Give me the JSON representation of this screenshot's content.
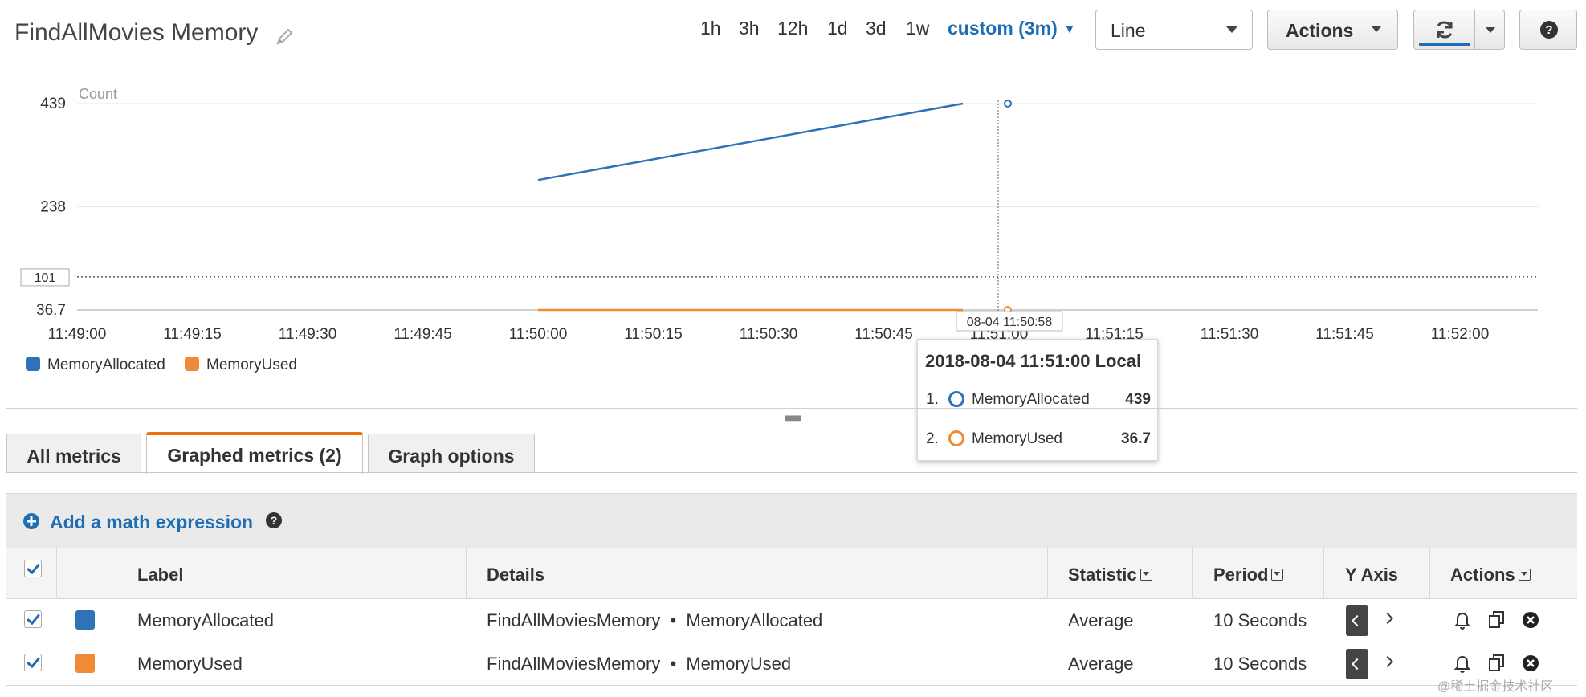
{
  "header": {
    "title": "FindAllMovies Memory",
    "time_ranges": [
      "1h",
      "3h",
      "12h",
      "1d",
      "3d",
      "1w"
    ],
    "custom_range_label": "custom (3m)",
    "chart_type_value": "Line",
    "actions_label": "Actions",
    "help_label": "?"
  },
  "chart_data": {
    "type": "line",
    "ylabel": "Count",
    "y_ticks": [
      "439",
      "238",
      "36.7"
    ],
    "threshold_label": "101",
    "x_ticks": [
      "11:49:00",
      "11:49:15",
      "11:49:30",
      "11:49:45",
      "11:50:00",
      "11:50:15",
      "11:50:30",
      "11:50:45",
      "11:51:00",
      "11:51:15",
      "11:51:30",
      "11:51:45",
      "11:52:00"
    ],
    "hover_label": "08-04 11:50:58",
    "threshold": 101,
    "grid": true,
    "series": [
      {
        "name": "MemoryAllocated",
        "color": "#2e73b8",
        "x": [
          "11:50:00",
          "11:51:00"
        ],
        "y": [
          290,
          439
        ],
        "hover_value": 439
      },
      {
        "name": "MemoryUsed",
        "color": "#ef8a36",
        "x": [
          "11:50:00",
          "11:51:00"
        ],
        "y": [
          36.7,
          36.7
        ],
        "hover_value": 36.7
      }
    ],
    "legend": "bottom-left"
  },
  "tooltip": {
    "title": "2018-08-04 11:51:00 Local",
    "rows": [
      {
        "index": "1.",
        "name": "MemoryAllocated",
        "value": "439",
        "color": "#2e73b8"
      },
      {
        "index": "2.",
        "name": "MemoryUsed",
        "value": "36.7",
        "color": "#ef8a36"
      }
    ]
  },
  "tabs": {
    "all_metrics": "All metrics",
    "graphed_metrics": "Graphed metrics (2)",
    "graph_options": "Graph options"
  },
  "toolbar": {
    "add_expression": "Add a math expression"
  },
  "table": {
    "headers": {
      "label": "Label",
      "details": "Details",
      "statistic": "Statistic",
      "period": "Period",
      "y_axis": "Y Axis",
      "actions": "Actions"
    },
    "rows": [
      {
        "label": "MemoryAllocated",
        "namespace": "FindAllMoviesMemory",
        "metric": "MemoryAllocated",
        "statistic": "Average",
        "period": "10 Seconds",
        "color": "#2e73b8"
      },
      {
        "label": "MemoryUsed",
        "namespace": "FindAllMoviesMemory",
        "metric": "MemoryUsed",
        "statistic": "Average",
        "period": "10 Seconds",
        "color": "#ef8a36"
      }
    ],
    "details_separator": "•"
  },
  "watermark": "@稀土掘金技术社区"
}
